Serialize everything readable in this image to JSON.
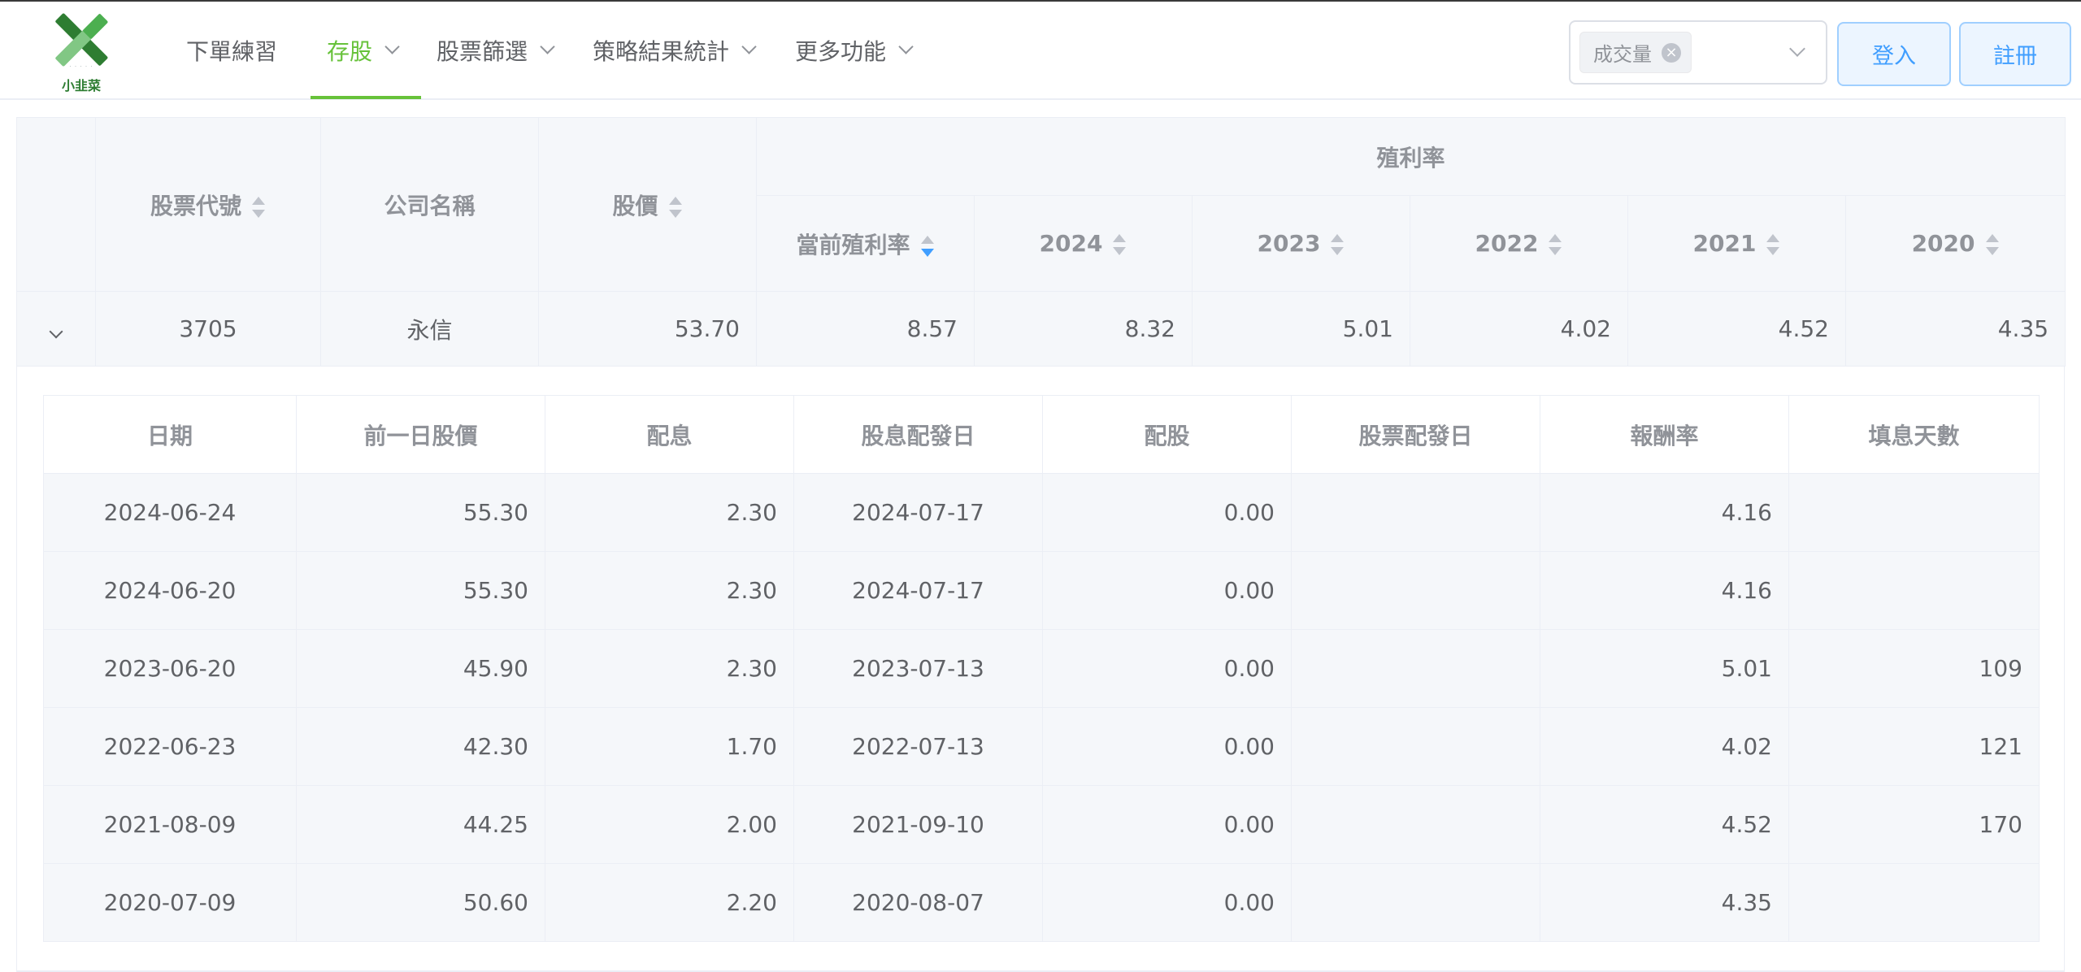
{
  "header": {
    "logo_text": "小韭菜",
    "nav": [
      {
        "label": "下單練習",
        "dropdown": false,
        "active": false
      },
      {
        "label": "存股",
        "dropdown": true,
        "active": true
      },
      {
        "label": "股票篩選",
        "dropdown": true,
        "active": false
      },
      {
        "label": "策略結果統計",
        "dropdown": true,
        "active": false
      },
      {
        "label": "更多功能",
        "dropdown": true,
        "active": false
      }
    ],
    "select_tag": "成交量",
    "login_label": "登入",
    "register_label": "註冊"
  },
  "main_table": {
    "group_header": "殖利率",
    "headers": {
      "code": "股票代號",
      "name": "公司名稱",
      "price": "股價",
      "current_yield": "當前殖利率",
      "y2024": "2024",
      "y2023": "2023",
      "y2022": "2022",
      "y2021": "2021",
      "y2020": "2020"
    },
    "row": {
      "code": "3705",
      "name": "永信",
      "price": "53.70",
      "current_yield": "8.57",
      "y2024": "8.32",
      "y2023": "5.01",
      "y2022": "4.02",
      "y2021": "4.52",
      "y2020": "4.35"
    }
  },
  "detail_table": {
    "headers": [
      "日期",
      "前一日股價",
      "配息",
      "股息配發日",
      "配股",
      "股票配發日",
      "報酬率",
      "填息天數"
    ],
    "rows": [
      [
        "2024-06-24",
        "55.30",
        "2.30",
        "2024-07-17",
        "0.00",
        "",
        "4.16",
        ""
      ],
      [
        "2024-06-20",
        "55.30",
        "2.30",
        "2024-07-17",
        "0.00",
        "",
        "4.16",
        ""
      ],
      [
        "2023-06-20",
        "45.90",
        "2.30",
        "2023-07-13",
        "0.00",
        "",
        "5.01",
        "109"
      ],
      [
        "2022-06-23",
        "42.30",
        "1.70",
        "2022-07-13",
        "0.00",
        "",
        "4.02",
        "121"
      ],
      [
        "2021-08-09",
        "44.25",
        "2.00",
        "2021-09-10",
        "0.00",
        "",
        "4.52",
        "170"
      ],
      [
        "2020-07-09",
        "50.60",
        "2.20",
        "2020-08-07",
        "0.00",
        "",
        "4.35",
        ""
      ]
    ]
  },
  "colors": {
    "accent_green": "#67c23a",
    "button_blue": "#409eff",
    "header_bg": "#f5f7fa"
  }
}
